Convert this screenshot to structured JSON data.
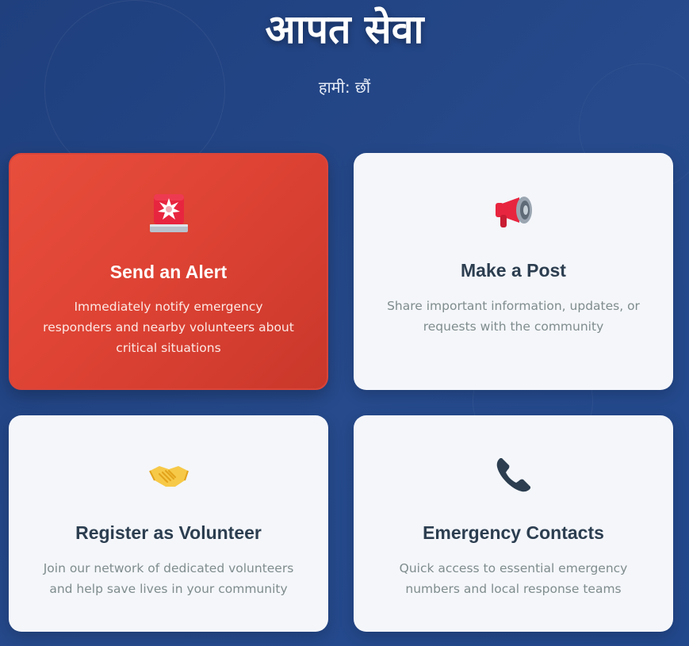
{
  "header": {
    "title": "आपत सेवा",
    "subtitle": "हामी: छौं"
  },
  "cards": [
    {
      "icon": "siren-icon",
      "title": "Send an Alert",
      "description": "Immediately notify emergency responders and nearby volunteers about critical situations",
      "accent": "#e74c3c"
    },
    {
      "icon": "megaphone-icon",
      "title": "Make a Post",
      "description": "Share important information, updates, or requests with the community"
    },
    {
      "icon": "handshake-icon",
      "title": "Register as Volunteer",
      "description": "Join our network of dedicated volunteers and help save lives in your community"
    },
    {
      "icon": "phone-icon",
      "title": "Emergency Contacts",
      "description": "Quick access to essential emergency numbers and local response teams"
    }
  ],
  "colors": {
    "background": "#244886",
    "alert_card": "#e74c3c",
    "card": "#f4f6fa",
    "card_title": "#2c3e50",
    "card_text": "#7f8c8d"
  }
}
